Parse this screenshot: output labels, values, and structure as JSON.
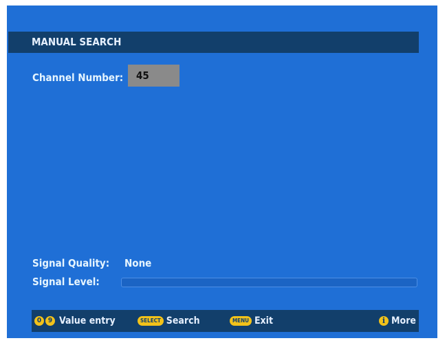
{
  "title": "MANUAL SEARCH",
  "channel": {
    "label": "Channel Number:",
    "value": "45"
  },
  "signal": {
    "quality_label": "Signal Quality:",
    "quality_value": "None",
    "level_label": "Signal Level:",
    "level_fraction": 0.0
  },
  "footer": {
    "key0": "0",
    "key9": "9",
    "value_entry": "Value entry",
    "select_key": "SELECT",
    "search": "Search",
    "menu_key": "MENU",
    "exit": "Exit",
    "info_key": "i",
    "more": "More"
  },
  "colors": {
    "background": "#1f6fd6",
    "bar": "#123f6b",
    "key": "#f2c21a",
    "value_box": "#8a8a8a"
  }
}
